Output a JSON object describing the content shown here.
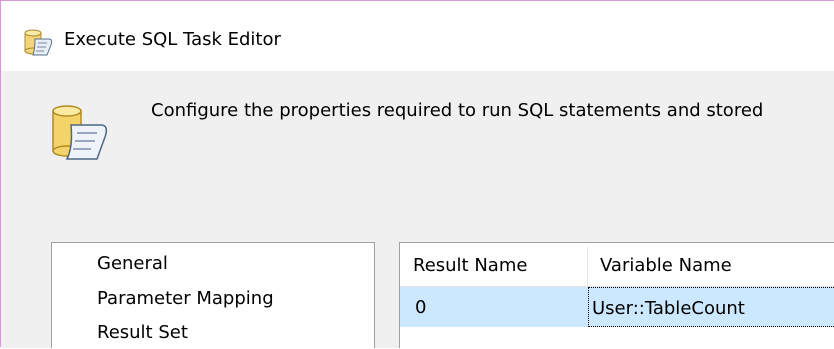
{
  "window": {
    "title": "Execute SQL Task Editor",
    "title_icon": "sql-task-icon"
  },
  "header": {
    "icon": "database-scroll-icon",
    "description": "Configure the properties required to run SQL statements and stored"
  },
  "sidebar": {
    "items": [
      {
        "label": "General",
        "selected": false
      },
      {
        "label": "Parameter Mapping",
        "selected": false
      },
      {
        "label": "Result Set",
        "selected": true
      }
    ]
  },
  "result_grid": {
    "columns": [
      "Result Name",
      "Variable Name"
    ],
    "rows": [
      {
        "result_name": "0",
        "variable_name": "User::TableCount",
        "selected": true
      }
    ]
  },
  "colors": {
    "window_border": "#d49ad4",
    "header_band": "#f0f0f0",
    "selected_row": "#cce8ff"
  }
}
